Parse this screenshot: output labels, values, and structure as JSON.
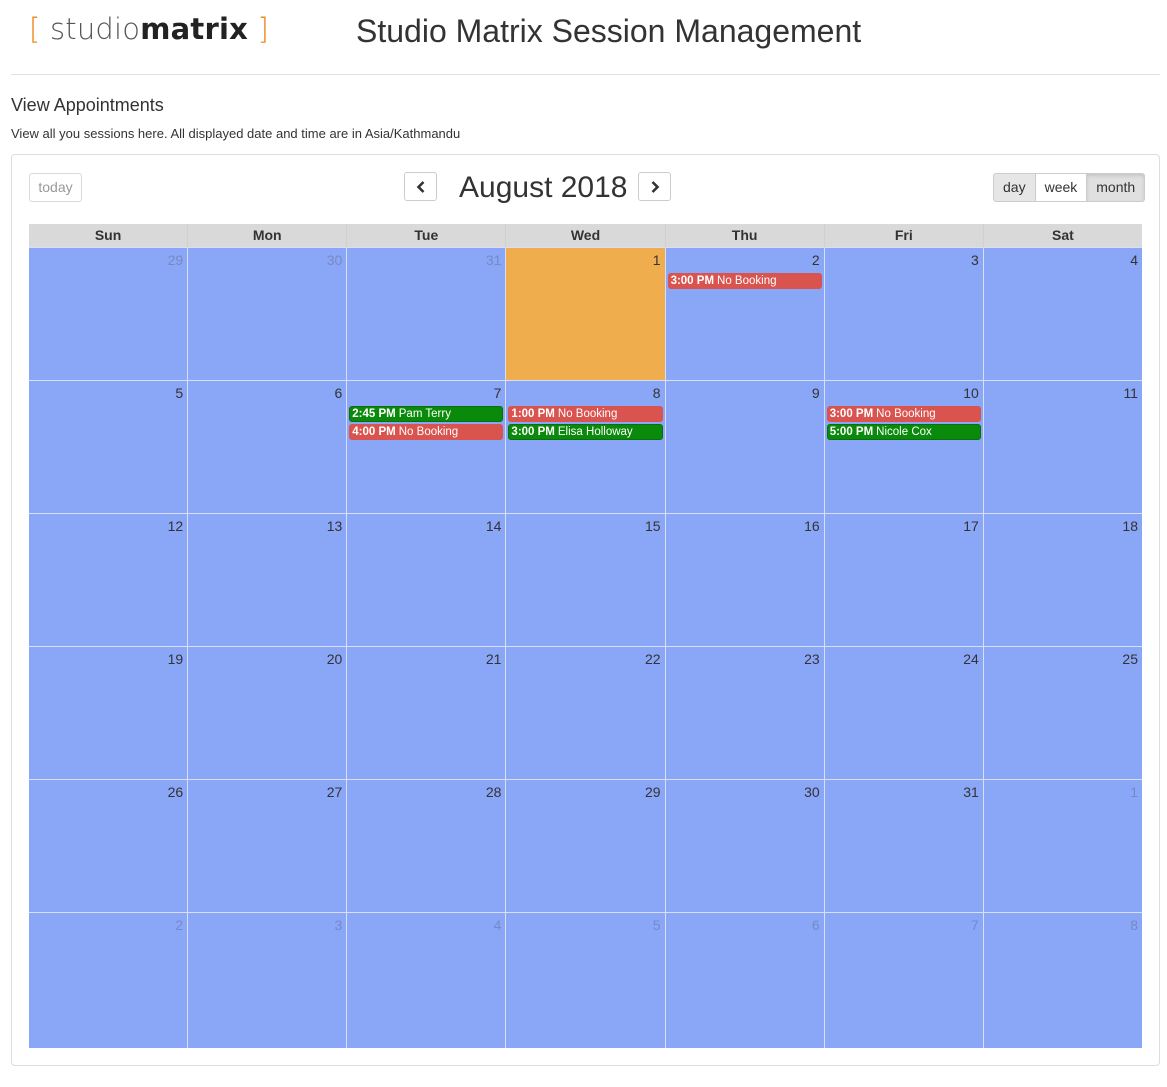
{
  "header": {
    "logo": {
      "open": "[",
      "studio": "studio",
      "matrix": "matrix",
      "close": "]"
    },
    "title": "Studio Matrix Session Management"
  },
  "section": {
    "title": "View Appointments",
    "description": "View all you sessions here. All displayed date and time are in Asia/Kathmandu"
  },
  "calendar": {
    "today_label": "today",
    "title": "August 2018",
    "views": [
      "day",
      "week",
      "month"
    ],
    "active_view": "month",
    "days_of_week": [
      "Sun",
      "Mon",
      "Tue",
      "Wed",
      "Thu",
      "Fri",
      "Sat"
    ],
    "colors": {
      "day_bg": "#8aa6f7",
      "today_bg": "#f0ad4e",
      "no_booking": "#d9534f",
      "booked": "#0a8a0a"
    },
    "weeks": [
      [
        {
          "num": "29",
          "other": true
        },
        {
          "num": "30",
          "other": true
        },
        {
          "num": "31",
          "other": true
        },
        {
          "num": "1",
          "today": true
        },
        {
          "num": "2",
          "events": [
            {
              "time": "3:00 PM",
              "title": "No Booking",
              "kind": "no-booking"
            }
          ]
        },
        {
          "num": "3"
        },
        {
          "num": "4"
        }
      ],
      [
        {
          "num": "5"
        },
        {
          "num": "6"
        },
        {
          "num": "7",
          "events": [
            {
              "time": "2:45 PM",
              "title": "Pam Terry",
              "kind": "booked"
            },
            {
              "time": "4:00 PM",
              "title": "No Booking",
              "kind": "no-booking"
            }
          ]
        },
        {
          "num": "8",
          "events": [
            {
              "time": "1:00 PM",
              "title": "No Booking",
              "kind": "no-booking"
            },
            {
              "time": "3:00 PM",
              "title": "Elisa Holloway",
              "kind": "booked"
            }
          ]
        },
        {
          "num": "9"
        },
        {
          "num": "10",
          "events": [
            {
              "time": "3:00 PM",
              "title": "No Booking",
              "kind": "no-booking"
            },
            {
              "time": "5:00 PM",
              "title": "Nicole Cox",
              "kind": "booked"
            }
          ]
        },
        {
          "num": "11"
        }
      ],
      [
        {
          "num": "12"
        },
        {
          "num": "13"
        },
        {
          "num": "14"
        },
        {
          "num": "15"
        },
        {
          "num": "16"
        },
        {
          "num": "17"
        },
        {
          "num": "18"
        }
      ],
      [
        {
          "num": "19"
        },
        {
          "num": "20"
        },
        {
          "num": "21"
        },
        {
          "num": "22"
        },
        {
          "num": "23"
        },
        {
          "num": "24"
        },
        {
          "num": "25"
        }
      ],
      [
        {
          "num": "26"
        },
        {
          "num": "27"
        },
        {
          "num": "28"
        },
        {
          "num": "29"
        },
        {
          "num": "30"
        },
        {
          "num": "31"
        },
        {
          "num": "1",
          "other": true
        }
      ],
      [
        {
          "num": "2",
          "other": true
        },
        {
          "num": "3",
          "other": true
        },
        {
          "num": "4",
          "other": true
        },
        {
          "num": "5",
          "other": true
        },
        {
          "num": "6",
          "other": true
        },
        {
          "num": "7",
          "other": true
        },
        {
          "num": "8",
          "other": true
        }
      ]
    ]
  }
}
